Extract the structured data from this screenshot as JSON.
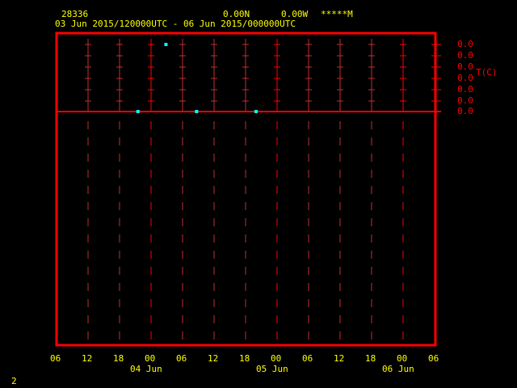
{
  "header": {
    "station_id": "28336",
    "latitude": "0.00N",
    "longitude": "0.00W",
    "elevation": "*****M",
    "time_range": "03 Jun 2015/120000UTC - 06 Jun 2015/000000UTC"
  },
  "footer": {
    "frame_number": "2"
  },
  "colors": {
    "background": "#000000",
    "frame": "#ff0000",
    "text": "#ffff00",
    "marker": "#00ffff",
    "grid_major": "#ff0000",
    "grid_minor": "#c03030"
  },
  "chart_data": {
    "type": "scatter",
    "title": "",
    "xlabel": "",
    "ylabel": "T(C)",
    "x_tick_labels": [
      "06",
      "12",
      "18",
      "00",
      "06",
      "12",
      "18",
      "00",
      "06",
      "12",
      "18",
      "00",
      "06"
    ],
    "x_date_labels": [
      {
        "label": "04 Jun",
        "at_tick": 3
      },
      {
        "label": "05 Jun",
        "at_tick": 7
      },
      {
        "label": "06 Jun",
        "at_tick": 11
      }
    ],
    "x_range": [
      "03 Jun 06:00",
      "06 Jun 06:00"
    ],
    "y_tick_labels": [
      "0.0",
      "0.0",
      "0.0",
      "0.0",
      "0.0",
      "0.0",
      "0.0"
    ],
    "grid": true,
    "points": [
      {
        "time": "03 Jun 21:30",
        "level": 0
      },
      {
        "time": "04 Jun 02:50",
        "level": 6
      },
      {
        "time": "04 Jun 08:40",
        "level": 0
      },
      {
        "time": "04 Jun 20:00",
        "level": 0
      }
    ]
  }
}
